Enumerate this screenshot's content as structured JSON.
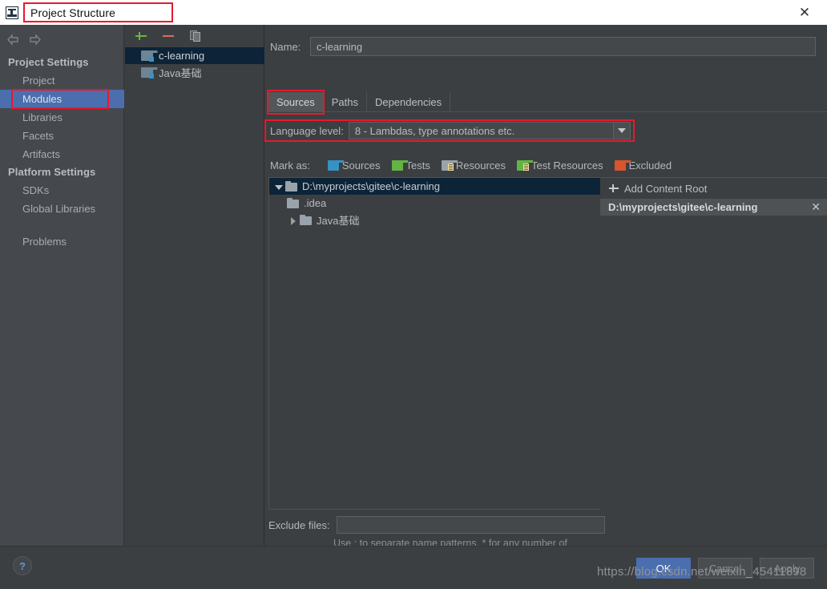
{
  "window": {
    "title": "Project Structure",
    "icon": "intellij-idea-icon",
    "close_label": "✕"
  },
  "sidebar": {
    "nav": {
      "back": "back-arrow",
      "forward": "forward-arrow"
    },
    "sections": [
      {
        "group": "Project Settings",
        "items": [
          {
            "label": "Project",
            "selected": false
          },
          {
            "label": "Modules",
            "selected": true
          },
          {
            "label": "Libraries",
            "selected": false
          },
          {
            "label": "Facets",
            "selected": false
          },
          {
            "label": "Artifacts",
            "selected": false
          }
        ]
      },
      {
        "group": "Platform Settings",
        "items": [
          {
            "label": "SDKs",
            "selected": false
          },
          {
            "label": "Global Libraries",
            "selected": false
          }
        ]
      }
    ],
    "problems": {
      "label": "Problems"
    }
  },
  "modules_panel": {
    "toolbar": [
      {
        "name": "add-module-button",
        "icon": "plus-icon"
      },
      {
        "name": "remove-module-button",
        "icon": "minus-icon"
      },
      {
        "name": "copy-module-button",
        "icon": "copy-icon"
      }
    ],
    "modules": [
      {
        "label": "c-learning",
        "selected": true
      },
      {
        "label": "Java基础",
        "selected": false
      }
    ]
  },
  "main": {
    "name": {
      "label": "Name:",
      "value": "c-learning"
    },
    "tabs": [
      {
        "label": "Sources",
        "active": true
      },
      {
        "label": "Paths",
        "active": false
      },
      {
        "label": "Dependencies",
        "active": false
      }
    ],
    "language_level": {
      "label": "Language level:",
      "value": "8 - Lambdas, type annotations etc.",
      "arrow": "chevron-down-icon"
    },
    "mark_as": {
      "label": "Mark as:",
      "options": [
        {
          "label": "Sources",
          "color": "#3592c4",
          "lines": false
        },
        {
          "label": "Tests",
          "color": "#62b543",
          "lines": false
        },
        {
          "label": "Resources",
          "color": "#9aa3ab",
          "lines": true
        },
        {
          "label": "Test Resources",
          "color": "#62b543",
          "lines": true
        },
        {
          "label": "Excluded",
          "color": "#d9552e",
          "lines": false
        }
      ]
    },
    "tree": [
      {
        "label": "D:\\myprojects\\gitee\\c-learning",
        "twisty": "down",
        "indent": 0,
        "selected": true
      },
      {
        "label": ".idea",
        "twisty": "none",
        "indent": 1,
        "selected": false
      },
      {
        "label": "Java基础",
        "twisty": "right",
        "indent": 1,
        "selected": false
      }
    ],
    "content_roots": {
      "add_label": "Add Content Root",
      "items": [
        {
          "path": "D:\\myprojects\\gitee\\c-learning",
          "remove": "✕"
        }
      ]
    },
    "exclude_files": {
      "label": "Exclude files:",
      "value": "",
      "placeholder": "",
      "hint": "Use ; to separate name patterns, * for any number of symbols, ? for one."
    }
  },
  "footer": {
    "help": "?",
    "buttons": [
      {
        "label": "OK",
        "primary": true
      },
      {
        "label": "Cancel",
        "primary": false
      },
      {
        "label": "Apply",
        "primary": false,
        "dim": true
      }
    ],
    "watermark": "https://blog.csdn.net/weixin_45411898"
  },
  "colors": {
    "accent_blue": "#4b6eaf",
    "highlight_red": "#e8192c",
    "panel_bg": "#3c3f41",
    "sidebar_bg": "#45484d",
    "tree_selected": "#0d2438"
  }
}
